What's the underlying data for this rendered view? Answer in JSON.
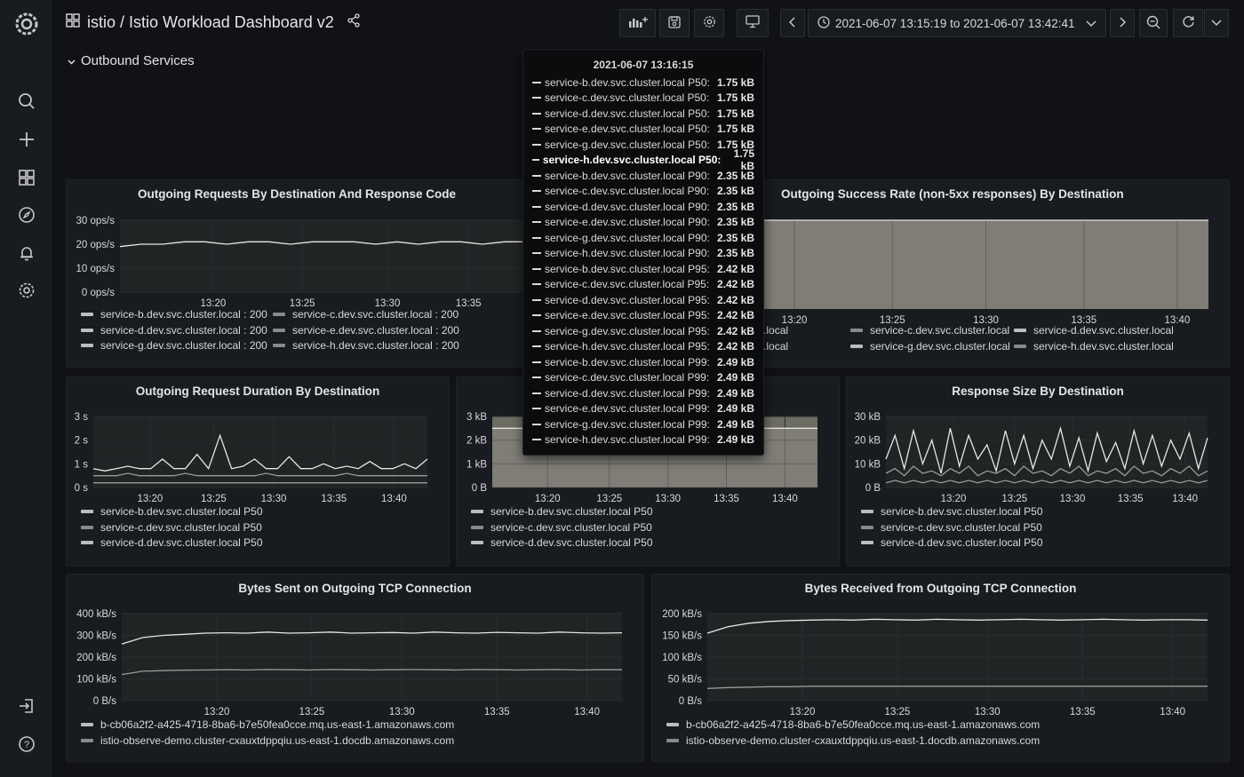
{
  "header": {
    "breadcrumb": "istio / Istio Workload Dashboard v2",
    "time_range": "2021-06-07 13:15:19 to 2021-06-07 13:42:41"
  },
  "row": {
    "title": "Outbound Services"
  },
  "colors": {
    "grid": "#2a2c30",
    "series": "#e6e6e6",
    "fill": "#4a4a3a",
    "background": "#111217"
  },
  "tooltip": {
    "time": "2021-06-07 13:16:15",
    "rows": [
      {
        "label": "service-b.dev.svc.cluster.local P50:",
        "value": "1.75 kB"
      },
      {
        "label": "service-c.dev.svc.cluster.local P50:",
        "value": "1.75 kB"
      },
      {
        "label": "service-d.dev.svc.cluster.local P50:",
        "value": "1.75 kB"
      },
      {
        "label": "service-e.dev.svc.cluster.local P50:",
        "value": "1.75 kB"
      },
      {
        "label": "service-g.dev.svc.cluster.local P50:",
        "value": "1.75 kB"
      },
      {
        "label": "service-h.dev.svc.cluster.local P50:",
        "value": "1.75 kB",
        "highlight": true
      },
      {
        "label": "service-b.dev.svc.cluster.local P90:",
        "value": "2.35 kB"
      },
      {
        "label": "service-c.dev.svc.cluster.local P90:",
        "value": "2.35 kB"
      },
      {
        "label": "service-d.dev.svc.cluster.local P90:",
        "value": "2.35 kB"
      },
      {
        "label": "service-e.dev.svc.cluster.local P90:",
        "value": "2.35 kB"
      },
      {
        "label": "service-g.dev.svc.cluster.local P90:",
        "value": "2.35 kB"
      },
      {
        "label": "service-h.dev.svc.cluster.local P90:",
        "value": "2.35 kB"
      },
      {
        "label": "service-b.dev.svc.cluster.local P95:",
        "value": "2.42 kB"
      },
      {
        "label": "service-c.dev.svc.cluster.local P95:",
        "value": "2.42 kB"
      },
      {
        "label": "service-d.dev.svc.cluster.local P95:",
        "value": "2.42 kB"
      },
      {
        "label": "service-e.dev.svc.cluster.local P95:",
        "value": "2.42 kB"
      },
      {
        "label": "service-g.dev.svc.cluster.local P95:",
        "value": "2.42 kB"
      },
      {
        "label": "service-h.dev.svc.cluster.local P95:",
        "value": "2.42 kB"
      },
      {
        "label": "service-b.dev.svc.cluster.local P99:",
        "value": "2.49 kB"
      },
      {
        "label": "service-c.dev.svc.cluster.local P99:",
        "value": "2.49 kB"
      },
      {
        "label": "service-d.dev.svc.cluster.local P99:",
        "value": "2.49 kB"
      },
      {
        "label": "service-e.dev.svc.cluster.local P99:",
        "value": "2.49 kB"
      },
      {
        "label": "service-g.dev.svc.cluster.local P99:",
        "value": "2.49 kB"
      },
      {
        "label": "service-h.dev.svc.cluster.local P99:",
        "value": "2.49 kB"
      }
    ]
  },
  "panels": {
    "p1": {
      "title": "Outgoing Requests By Destination And Response Code",
      "legend": [
        "service-b.dev.svc.cluster.local : 200",
        "service-c.dev.svc.cluster.local : 200",
        "service-d.dev.svc.cluster.local : 200",
        "service-e.dev.svc.cluster.local : 200",
        "service-g.dev.svc.cluster.local : 200",
        "service-h.dev.svc.cluster.local : 200"
      ]
    },
    "p2": {
      "title": "Outgoing Success Rate (non-5xx responses) By Destination",
      "legend": [
        ".cluster.local",
        "service-c.dev.svc.cluster.local",
        "service-d.dev.svc.cluster.local",
        ".cluster.local",
        "service-g.dev.svc.cluster.local",
        "service-h.dev.svc.cluster.local"
      ]
    },
    "p3": {
      "title": "Outgoing Request Duration By Destination",
      "legend": [
        "service-b.dev.svc.cluster.local P50",
        "service-c.dev.svc.cluster.local P50",
        "service-d.dev.svc.cluster.local P50"
      ]
    },
    "p4": {
      "title": "",
      "legend": [
        "service-b.dev.svc.cluster.local P50",
        "service-c.dev.svc.cluster.local P50",
        "service-d.dev.svc.cluster.local P50"
      ]
    },
    "p5": {
      "title": "Response Size By Destination",
      "legend": [
        "service-b.dev.svc.cluster.local P50",
        "service-c.dev.svc.cluster.local P50",
        "service-d.dev.svc.cluster.local P50"
      ]
    },
    "p6": {
      "title": "Bytes Sent on Outgoing TCP Connection",
      "legend": [
        "b-cb06a2f2-a425-4718-8ba6-b7e50fea0cce.mq.us-east-1.amazonaws.com",
        "istio-observe-demo.cluster-cxauxtdppqiu.us-east-1.docdb.amazonaws.com"
      ]
    },
    "p7": {
      "title": "Bytes Received from Outgoing TCP Connection",
      "legend": [
        "b-cb06a2f2-a425-4718-8ba6-b7e50fea0cce.mq.us-east-1.amazonaws.com",
        "istio-observe-demo.cluster-cxauxtdppqiu.us-east-1.docdb.amazonaws.com"
      ]
    }
  },
  "chart_data": [
    {
      "id": "p1",
      "type": "line",
      "title": "Outgoing Requests By Destination And Response Code",
      "y_ticks": [
        "30 ops/s",
        "20 ops/s",
        "10 ops/s",
        "0 ops/s"
      ],
      "ylim": [
        0,
        30
      ],
      "x_ticks": [
        "13:20",
        "13:25",
        "13:30",
        "13:35"
      ],
      "series": [
        {
          "name": "service-b.dev.svc.cluster.local : 200",
          "values": [
            19,
            20,
            20,
            21,
            21,
            20,
            21,
            21,
            20,
            21,
            21,
            21,
            20,
            21,
            20,
            21,
            21,
            20,
            21,
            21
          ]
        }
      ]
    },
    {
      "id": "p2",
      "type": "area",
      "title": "Outgoing Success Rate (non-5xx responses) By Destination",
      "x_ticks": [
        "13:20",
        "13:25",
        "13:30",
        "13:35",
        "13:40"
      ],
      "series": [
        {
          "name": "service-c.dev.svc.cluster.local",
          "values": [
            100,
            100,
            100,
            100,
            100,
            100,
            100,
            100,
            100,
            100
          ]
        }
      ]
    },
    {
      "id": "p3",
      "type": "line",
      "title": "Outgoing Request Duration By Destination",
      "y_ticks": [
        "3 s",
        "2 s",
        "1 s",
        "0 s"
      ],
      "ylim": [
        0,
        3
      ],
      "x_ticks": [
        "13:20",
        "13:25",
        "13:30",
        "13:35",
        "13:40"
      ],
      "series": [
        {
          "name": "service-b.dev.svc.cluster.local P50",
          "values": [
            0.8,
            0.7,
            0.8,
            0.9,
            0.8,
            0.8,
            1.2,
            0.8,
            0.8,
            1.4,
            0.8,
            2.2,
            0.8,
            0.9,
            1.2,
            0.8,
            0.8,
            1.3,
            0.8,
            0.8,
            1.0,
            0.8,
            0.9,
            0.8,
            1.1,
            0.8,
            0.8,
            1.0,
            0.8,
            1.2
          ]
        },
        {
          "name": "service-c.dev.svc.cluster.local P50",
          "values": [
            0.5,
            0.5,
            0.5,
            0.6,
            0.5,
            0.5,
            0.5,
            0.5,
            0.6,
            0.5,
            0.5,
            0.5,
            0.5,
            0.5,
            0.5,
            0.6,
            0.5,
            0.5,
            0.5,
            0.5,
            0.5,
            0.5,
            0.6,
            0.5,
            0.5,
            0.5,
            0.5,
            0.5,
            0.5,
            0.5
          ]
        },
        {
          "name": "service-d.dev.svc.cluster.local P50",
          "values": [
            0.2,
            0.2,
            0.2,
            0.2,
            0.2,
            0.2,
            0.2,
            0.2,
            0.2,
            0.2,
            0.2,
            0.2,
            0.2,
            0.2,
            0.2,
            0.2,
            0.2,
            0.2,
            0.2,
            0.2,
            0.2,
            0.2,
            0.2,
            0.2,
            0.2,
            0.2,
            0.2,
            0.2,
            0.2,
            0.2
          ]
        }
      ]
    },
    {
      "id": "p4",
      "type": "area",
      "title": "",
      "y_ticks": [
        "3 kB",
        "2 kB",
        "1 kB",
        "0 B"
      ],
      "ylim": [
        0,
        3
      ],
      "x_ticks": [
        "13:20",
        "13:25",
        "13:30",
        "13:35",
        "13:40"
      ],
      "series": [
        {
          "name": "service-b.dev.svc.cluster.local P50",
          "values": [
            2.5,
            2.5,
            2.5,
            2.5,
            2.5,
            2.5,
            2.5,
            2.5,
            2.5,
            2.5
          ]
        }
      ]
    },
    {
      "id": "p5",
      "type": "line",
      "title": "Response Size By Destination",
      "y_ticks": [
        "30 kB",
        "20 kB",
        "10 kB",
        "0 B"
      ],
      "ylim": [
        0,
        30
      ],
      "x_ticks": [
        "13:20",
        "13:25",
        "13:30",
        "13:35",
        "13:40"
      ],
      "series": [
        {
          "name": "service-b.dev.svc.cluster.local P50",
          "values": [
            12,
            22,
            8,
            24,
            10,
            20,
            6,
            25,
            9,
            22,
            12,
            18,
            7,
            24,
            10,
            22,
            8,
            20,
            12,
            25,
            9,
            21,
            7,
            23,
            11,
            19,
            8,
            24,
            10,
            22,
            9,
            20,
            12,
            23,
            8,
            21
          ]
        },
        {
          "name": "service-c.dev.svc.cluster.local P50",
          "values": [
            6,
            8,
            5,
            9,
            6,
            7,
            5,
            8,
            6,
            9,
            5,
            7,
            6,
            8,
            5,
            9,
            6,
            7,
            5,
            8,
            6,
            9,
            5,
            7,
            6,
            8,
            5,
            9,
            6,
            7,
            5,
            8,
            6,
            9,
            5,
            7
          ]
        },
        {
          "name": "service-d.dev.svc.cluster.local P50",
          "values": [
            2,
            3,
            2,
            3,
            2,
            3,
            2,
            3,
            2,
            3,
            2,
            3,
            2,
            3,
            2,
            3,
            2,
            3,
            2,
            3,
            2,
            3,
            2,
            3,
            2,
            3,
            2,
            3,
            2,
            3,
            2,
            3,
            2,
            3,
            2,
            3
          ]
        }
      ]
    },
    {
      "id": "p6",
      "type": "line",
      "title": "Bytes Sent on Outgoing TCP Connection",
      "y_ticks": [
        "400 kB/s",
        "300 kB/s",
        "200 kB/s",
        "100 kB/s",
        "0 B/s"
      ],
      "ylim": [
        0,
        400
      ],
      "x_ticks": [
        "13:20",
        "13:25",
        "13:30",
        "13:35",
        "13:40"
      ],
      "series": [
        {
          "name": "b-cb06a2f2-a425-4718-8ba6-b7e50fea0cce.mq.us-east-1.amazonaws.com",
          "values": [
            260,
            290,
            300,
            305,
            310,
            312,
            310,
            315,
            310,
            312,
            315,
            310,
            312,
            313,
            310,
            315,
            312,
            310,
            314,
            312,
            310,
            315,
            312,
            310,
            312
          ]
        },
        {
          "name": "istio-observe-demo.cluster-cxauxtdppqiu.us-east-1.docdb.amazonaws.com",
          "values": [
            120,
            135,
            138,
            140,
            141,
            142,
            141,
            143,
            142,
            141,
            143,
            142,
            141,
            142,
            143,
            142,
            141,
            143,
            142,
            141,
            142,
            143,
            141,
            142,
            142
          ]
        }
      ]
    },
    {
      "id": "p7",
      "type": "line",
      "title": "Bytes Received from Outgoing TCP Connection",
      "y_ticks": [
        "200 kB/s",
        "150 kB/s",
        "100 kB/s",
        "50 kB/s",
        "0 B/s"
      ],
      "ylim": [
        0,
        200
      ],
      "x_ticks": [
        "13:20",
        "13:25",
        "13:30",
        "13:35",
        "13:40"
      ],
      "series": [
        {
          "name": "b-cb06a2f2-a425-4718-8ba6-b7e50fea0cce.mq.us-east-1.amazonaws.com",
          "values": [
            155,
            170,
            178,
            182,
            184,
            185,
            186,
            185,
            187,
            186,
            185,
            187,
            186,
            185,
            186,
            187,
            186,
            185,
            186,
            187,
            186,
            185,
            186,
            186,
            185
          ]
        },
        {
          "name": "istio-observe-demo.cluster-cxauxtdppqiu.us-east-1.docdb.amazonaws.com",
          "values": [
            28,
            30,
            31,
            32,
            32,
            33,
            33,
            33,
            33,
            33,
            33,
            33,
            33,
            33,
            33,
            33,
            33,
            33,
            33,
            33,
            33,
            33,
            33,
            33,
            33
          ]
        }
      ]
    }
  ]
}
